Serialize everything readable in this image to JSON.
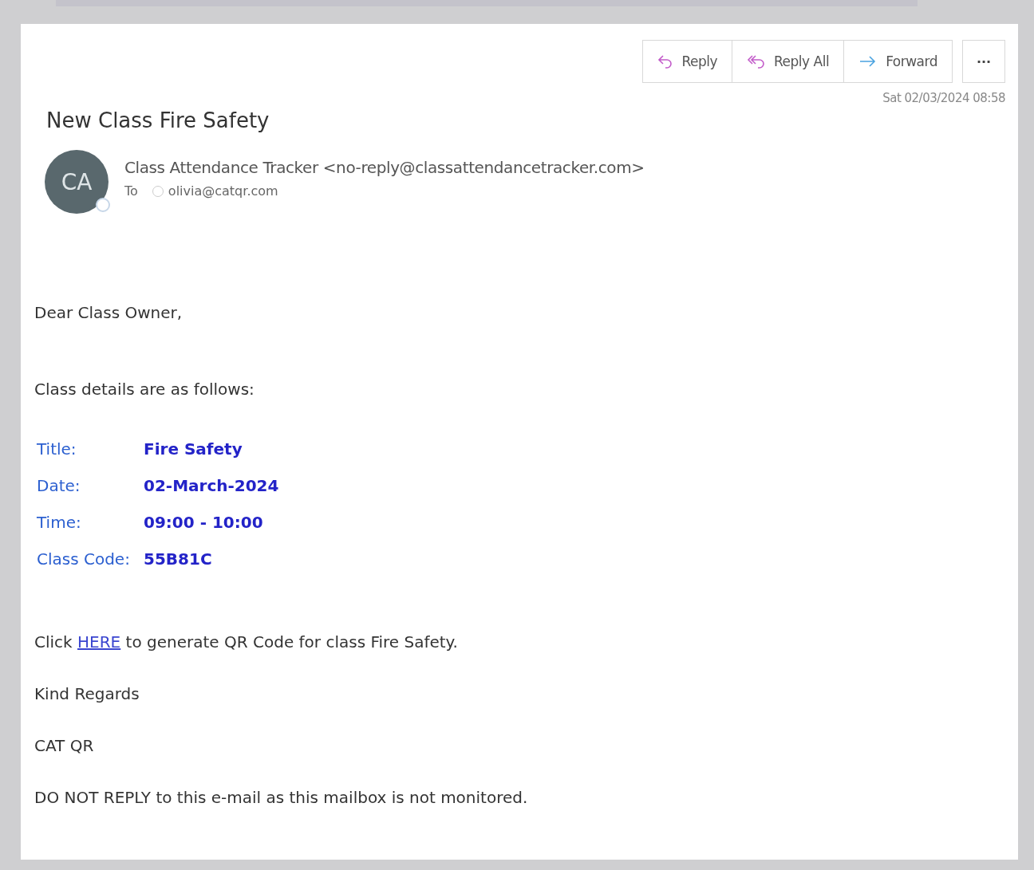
{
  "actions": [
    {
      "kind": "reply",
      "label": "Reply"
    },
    {
      "kind": "reply-all",
      "label": "Reply All"
    },
    {
      "kind": "forward",
      "label": "Forward"
    }
  ],
  "more_button": "···",
  "date": "Sat 02/03/2024 08:58",
  "subject": "New Class Fire Safety",
  "sender": {
    "initials": "CA",
    "from": "Class Attendance Tracker <no-reply@classattendancetracker.com>",
    "to_label": "To",
    "to": "olivia@catqr.com"
  },
  "body": {
    "greeting": "Dear Class Owner,",
    "intro": "Class details are as follows:",
    "details": [
      {
        "label": "Title:",
        "value": "Fire Safety"
      },
      {
        "label": "Date:",
        "value": "02-March-2024"
      },
      {
        "label": "Time:",
        "value": "09:00 - 10:00"
      },
      {
        "label": "Class Code:",
        "value": "55B81C"
      }
    ],
    "link_line": {
      "before": "Click",
      "link": "HERE",
      "after": "to generate QR Code for class Fire Safety."
    },
    "closing": "Kind Regards",
    "signature": "CAT QR",
    "notice": "DO NOT REPLY to this e-mail as this mailbox is not monitored."
  }
}
